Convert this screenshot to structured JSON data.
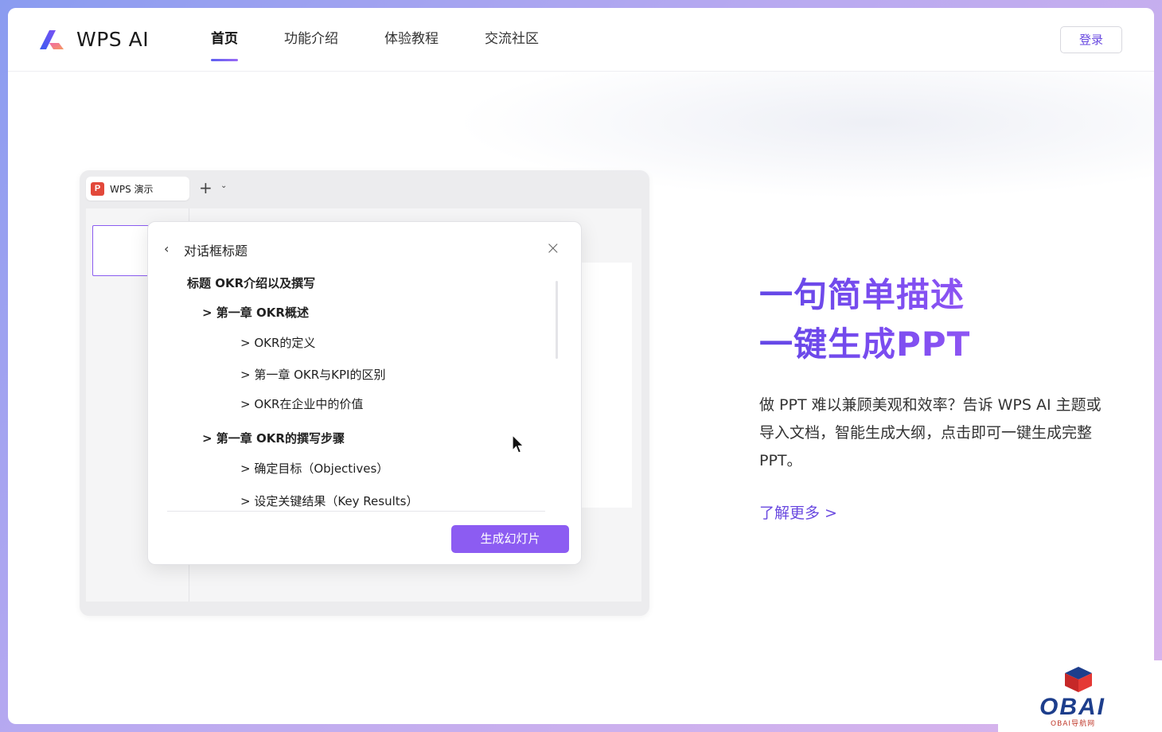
{
  "header": {
    "logo_text": "WPS AI",
    "nav": [
      {
        "label": "首页",
        "active": true
      },
      {
        "label": "功能介绍",
        "active": false
      },
      {
        "label": "体验教程",
        "active": false
      },
      {
        "label": "交流社区",
        "active": false
      }
    ],
    "login_label": "登录"
  },
  "mockup": {
    "app_tab_icon": "P",
    "app_tab_label": "WPS 演示",
    "new_tab_symbol": "+",
    "tab_menu_symbol": "⌄",
    "dialog": {
      "back_symbol": "‹",
      "title": "对话框标题",
      "close_symbol": "×",
      "outline": {
        "title": "标题   OKR介绍以及撰写",
        "chapter1": "> 第一章   OKR概述",
        "c1_items": [
          "> OKR的定义",
          "> 第一章   OKR与KPI的区别",
          "> OKR在企业中的价值"
        ],
        "chapter2": "> 第一章   OKR的撰写步骤",
        "c2_items": [
          "> 确定目标（Objectives）",
          "> 设定关键结果（Key Results）"
        ]
      },
      "generate_label": "生成幻灯片"
    }
  },
  "hero": {
    "headline_line1": "一句简单描述",
    "headline_line2": "一键生成PPT",
    "description": "做 PPT 难以兼顾美观和效率？告诉 WPS AI 主题或导入文档，智能生成大纲，点击即可一键生成完整 PPT。",
    "learn_more": "了解更多 >"
  },
  "watermark": {
    "text": "OBAI",
    "subtext": "OBAI导航网"
  },
  "colors": {
    "accent": "#7b4cf0",
    "button": "#8c5cf2",
    "ppt_icon": "#e2483a"
  }
}
